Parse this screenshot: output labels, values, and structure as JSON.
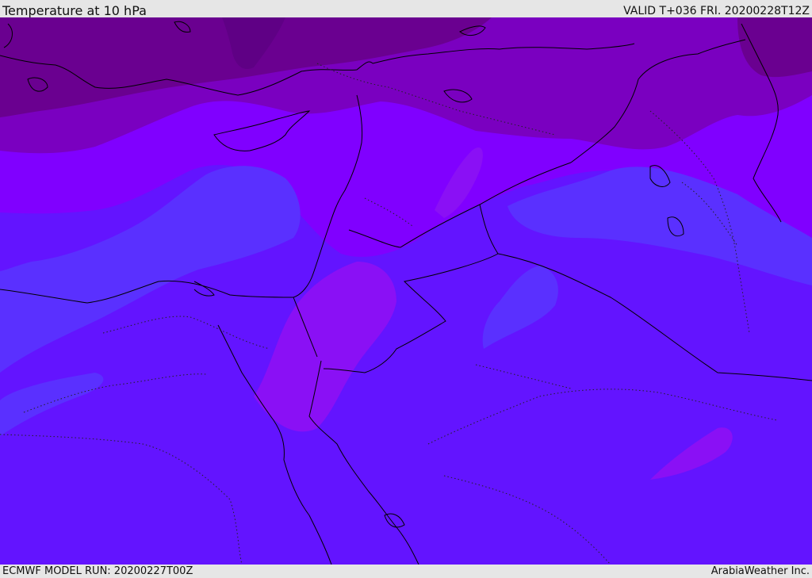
{
  "header": {
    "title": "Temperature at 10 hPa",
    "valid": "VALID T+036 FRI. 20200228T12Z"
  },
  "footer": {
    "model_run": "ECMWF MODEL RUN: 20200227T00Z",
    "credit": "ArabiaWeather Inc."
  },
  "map": {
    "colors": {
      "coldest": "#6a0090",
      "cold": "#7a00c0",
      "mid": "#8000ff",
      "base": "#6314ff",
      "cool_blue": "#5a30ff",
      "warm_pocket": "#8a10f5",
      "coastline": "#000000"
    }
  }
}
